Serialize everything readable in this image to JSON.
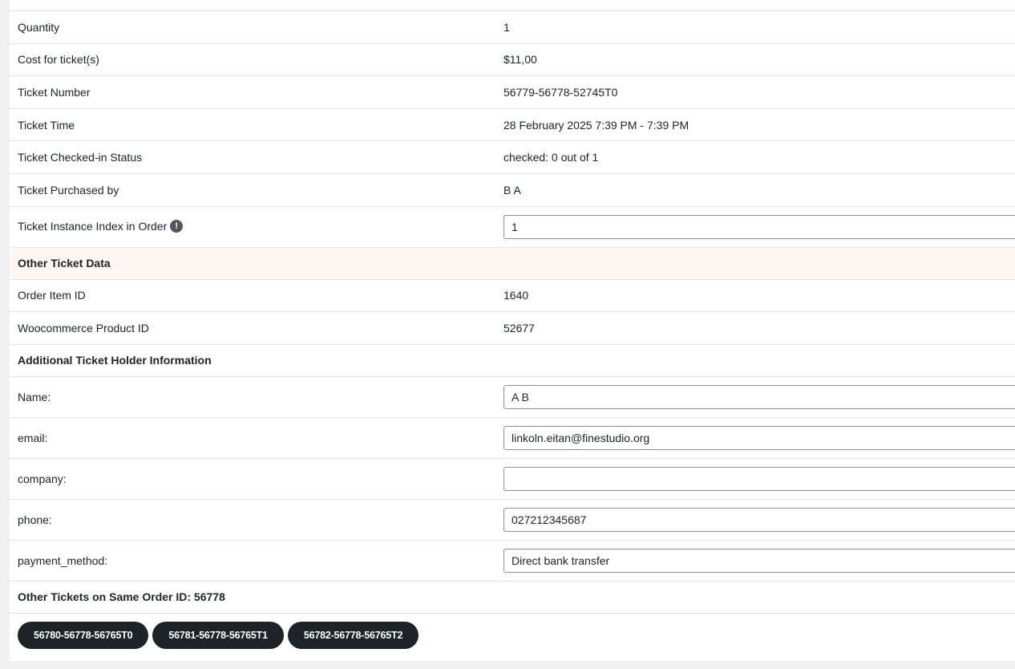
{
  "rows": [
    {
      "label": "Quantity",
      "value": "1"
    },
    {
      "label": "Cost for ticket(s)",
      "value": "$11,00"
    },
    {
      "label": "Ticket Number",
      "value": "56779-56778-52745T0"
    },
    {
      "label": "Ticket Time",
      "value": "28 February 2025 7:39 PM - 7:39 PM"
    },
    {
      "label": "Ticket Checked-in Status",
      "value": "checked: 0 out of 1"
    },
    {
      "label": "Ticket Purchased by",
      "value": "B A"
    }
  ],
  "instance_index": {
    "label": "Ticket Instance Index in Order",
    "info_icon": "!",
    "value": "1"
  },
  "other_section": {
    "title": "Other Ticket Data",
    "rows": [
      {
        "label": "Order Item ID",
        "value": "1640"
      },
      {
        "label": "Woocommerce Product ID",
        "value": "52677"
      }
    ]
  },
  "holder_section": {
    "title": "Additional Ticket Holder Information",
    "fields": [
      {
        "label": "Name:",
        "value": "A B"
      },
      {
        "label": "email:",
        "value": "linkoln.eitan@finestudio.org"
      },
      {
        "label": "company:",
        "value": ""
      },
      {
        "label": "phone:",
        "value": "027212345687"
      },
      {
        "label": "payment_method:",
        "value": "Direct bank transfer"
      }
    ]
  },
  "other_tickets": {
    "title": "Other Tickets on Same Order ID: 56778",
    "buttons": [
      "56780-56778-56765T0",
      "56781-56778-56765T1",
      "56782-56778-56765T2"
    ]
  },
  "colors": {
    "accent_bg": "#fff8f2",
    "button_bg": "#1d2327"
  }
}
